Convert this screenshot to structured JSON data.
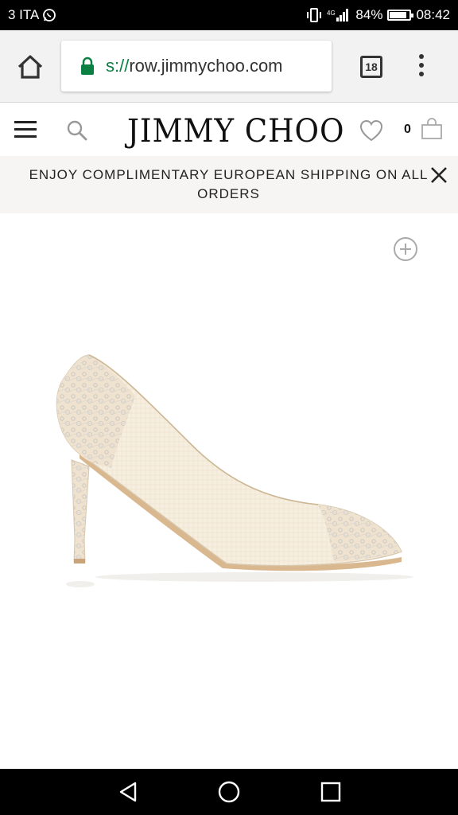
{
  "status_bar": {
    "carrier": "3 ITA",
    "battery_percent_label": "84%",
    "battery_level": 0.84,
    "time": "08:42",
    "icons": [
      "whatsapp-icon",
      "vibrate-icon",
      "signal-icon",
      "battery-icon"
    ]
  },
  "browser": {
    "url_scheme": "s://",
    "url_host": "row.jimmychoo.com",
    "tab_count": "18",
    "icons": [
      "home-icon",
      "lock-icon",
      "overflow-menu-icon"
    ]
  },
  "header": {
    "logo_text": "JIMMY CHOO",
    "bag_count": "0",
    "icons": [
      "hamburger-menu-icon",
      "search-icon",
      "heart-icon",
      "shopping-bag-icon"
    ]
  },
  "promo": {
    "text": "ENJOY COMPLIMENTARY EUROPEAN SHIPPING ON ALL ORDERS",
    "close_icon": "close-icon"
  },
  "product": {
    "zoom_icon": "zoom-in-icon",
    "image": "lace-pointed-pump"
  },
  "system_nav": {
    "icons": [
      "back-icon",
      "home-circle-icon",
      "recents-icon"
    ]
  },
  "colors": {
    "url_scheme": "#0b8043",
    "lock": "#0b8043",
    "status_bar_bg": "#000000",
    "promo_bg": "#f7f5f3"
  }
}
